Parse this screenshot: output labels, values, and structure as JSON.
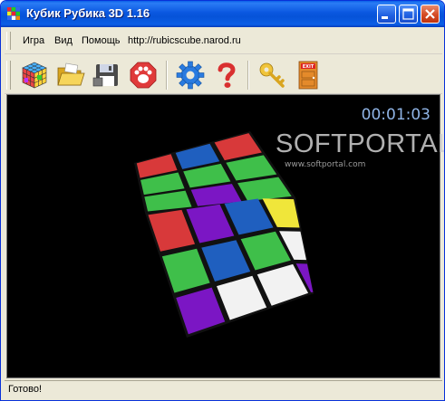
{
  "window": {
    "title": "Кубик Рубика 3D 1.16"
  },
  "menu": {
    "items": [
      "Игра",
      "Вид",
      "Помощь",
      "http://rubicscube.narod.ru"
    ]
  },
  "toolbar": {
    "buttons": [
      {
        "icon": "rubik-cube-icon"
      },
      {
        "icon": "open-folder-icon"
      },
      {
        "icon": "save-floppy-icon"
      },
      {
        "icon": "paw-icon"
      },
      {
        "icon": "gear-icon"
      },
      {
        "icon": "help-icon"
      },
      {
        "icon": "key-icon"
      },
      {
        "icon": "exit-door-icon",
        "label": "EXIT"
      }
    ]
  },
  "viewport": {
    "timer": "00:01:03",
    "watermark": {
      "text": "SOFTPORTAL",
      "url": "www.softportal.com"
    },
    "cube_faces": {
      "top": [
        "red",
        "blue",
        "red",
        "green",
        "green",
        "green",
        "green",
        "purple",
        "green"
      ],
      "left": [
        "red",
        "purple",
        "blue",
        "green",
        "blue",
        "green",
        "purple",
        "white",
        "white"
      ],
      "right": [
        "yellow",
        "white",
        "purple"
      ]
    }
  },
  "colors": {
    "red": "#d8393a",
    "blue": "#1f5fbf",
    "green": "#3fbf4a",
    "purple": "#7b16c4",
    "white": "#f2f2f2",
    "yellow": "#f0e63a",
    "cyan": "#2aa4e8"
  },
  "status": {
    "text": "Готово!"
  }
}
